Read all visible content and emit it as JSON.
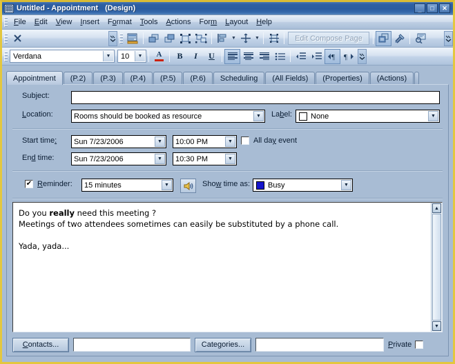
{
  "window": {
    "title": "Untitled - Appointment",
    "title_suffix": "(Design)",
    "icon": "appointment-grid-icon",
    "minimize_glyph": "_",
    "maximize_glyph": "□",
    "close_glyph": "✕",
    "frame_color": "#e3c73f",
    "titlebar_color": "#2a5ca0",
    "body_color": "#a8bcd4"
  },
  "menubar": {
    "items": [
      {
        "label": "File"
      },
      {
        "label": "Edit"
      },
      {
        "label": "View"
      },
      {
        "label": "Insert"
      },
      {
        "label": "Format"
      },
      {
        "label": "Tools"
      },
      {
        "label": "Actions"
      },
      {
        "label": "Form"
      },
      {
        "label": "Layout"
      },
      {
        "label": "Help"
      }
    ]
  },
  "toolbar_standard": {
    "close_icon": "✕",
    "edit_compose_page_label": "Edit Compose Page",
    "icons": [
      "close-icon",
      "field-chooser-icon",
      "bring-to-front-icon",
      "send-to-back-icon",
      "group-icon",
      "ungroup-icon",
      "align-left-icon",
      "size-icon",
      "arrange-icon",
      "tab-order-icon",
      "control-toolbox-icon",
      "properties-icon",
      "view-code-icon"
    ],
    "overflow_glyph": "»"
  },
  "toolbar_formatting": {
    "font_name": "Verdana",
    "font_size": "10",
    "font_color_glyph": "A",
    "font_color": "#cc2200",
    "bold_glyph": "B",
    "italic_glyph": "I",
    "underline_glyph": "U",
    "icons": [
      "align-left-icon",
      "align-center-icon",
      "align-right-icon",
      "bullets-icon",
      "decrease-indent-icon",
      "increase-indent-icon",
      "ltr-paragraph-icon",
      "rtl-paragraph-icon"
    ],
    "overflow_glyph": "»"
  },
  "tabs": [
    {
      "label": "Appointment",
      "active": true
    },
    {
      "label": "(P.2)",
      "active": false
    },
    {
      "label": "(P.3)",
      "active": false
    },
    {
      "label": "(P.4)",
      "active": false
    },
    {
      "label": "(P.5)",
      "active": false
    },
    {
      "label": "(P.6)",
      "active": false
    },
    {
      "label": "Scheduling",
      "active": false
    },
    {
      "label": "(All Fields)",
      "active": false
    },
    {
      "label": "(Properties)",
      "active": false
    },
    {
      "label": "(Actions)",
      "active": false
    }
  ],
  "form": {
    "subject_label": "Subject:",
    "subject_value": "",
    "location_label": "Location:",
    "location_value": "Rooms should be booked as resource",
    "label_label": "Label:",
    "label_value": "None",
    "label_swatch_color": "#ffffff",
    "start_time_label": "Start time:",
    "start_date_value": "Sun 7/23/2006",
    "start_clock_value": "10:00 PM",
    "end_time_label": "End time:",
    "end_date_value": "Sun 7/23/2006",
    "end_clock_value": "10:30 PM",
    "all_day_label": "All day event",
    "all_day_checked": false,
    "reminder_label": "Reminder:",
    "reminder_checked": true,
    "reminder_value": "15 minutes",
    "reminder_sound_icon": "speaker-icon",
    "show_time_as_label": "Show time as:",
    "show_time_as_value": "Busy",
    "show_time_as_color": "#1515cc",
    "checkmark_glyph": "✔",
    "dropdown_glyph": "▼"
  },
  "body": {
    "line1_pre": "Do you ",
    "line1_bold": "really",
    "line1_post": " need this meeting ?",
    "line2": "Meetings of two attendees sometimes can easily be substituted by a phone call.",
    "line3": "",
    "line4": "Yada, yada...",
    "scroll_up_glyph": "▲",
    "scroll_down_glyph": "▼"
  },
  "bottombar": {
    "contacts_label": "Contacts...",
    "contacts_value": "",
    "categories_label": "Categories...",
    "categories_value": "",
    "private_label": "Private",
    "private_checked": false
  }
}
